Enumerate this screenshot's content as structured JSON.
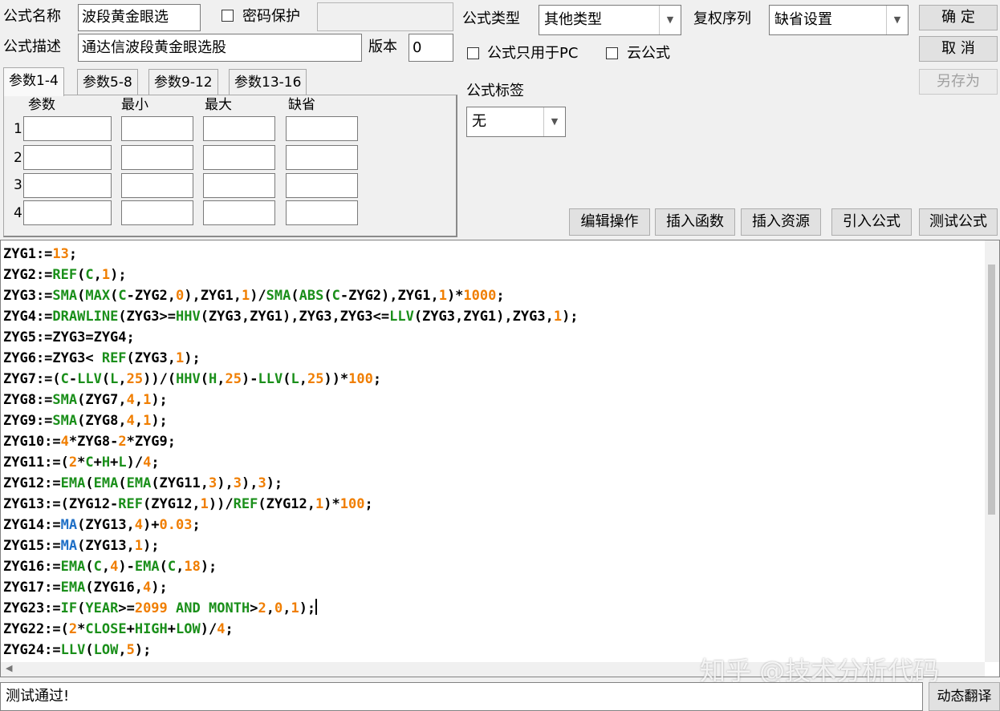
{
  "header": {
    "name_label": "公式名称",
    "name_value": "波段黄金眼选",
    "password_label": "密码保护",
    "desc_label": "公式描述",
    "desc_value": "通达信波段黄金眼选股",
    "version_label": "版本",
    "version_value": "0",
    "type_label": "公式类型",
    "type_value": "其他类型",
    "rights_label": "复权序列",
    "rights_value": "缺省设置",
    "pc_only_label": "公式只用于PC",
    "cloud_label": "云公式",
    "tag_label": "公式标签",
    "tag_value": "无"
  },
  "buttons": {
    "confirm": "确 定",
    "cancel": "取 消",
    "save_as": "另存为",
    "edit_ops": "编辑操作",
    "insert_fn": "插入函数",
    "insert_res": "插入资源",
    "import_formula": "引入公式",
    "test_formula": "测试公式",
    "dynamic_translate": "动态翻译"
  },
  "params": {
    "tabs": [
      "参数1-4",
      "参数5-8",
      "参数9-12",
      "参数13-16"
    ],
    "columns": [
      "参数",
      "最小",
      "最大",
      "缺省"
    ],
    "rows": [
      "1",
      "2",
      "3",
      "4"
    ]
  },
  "status_text": "测试通过!",
  "watermark": "知乎 @技术分析代码",
  "code_lines": [
    [
      [
        "ZYG1:=",
        "id"
      ],
      [
        "13",
        "num"
      ],
      [
        ";",
        "id"
      ]
    ],
    [
      [
        "ZYG2:=",
        "id"
      ],
      [
        "REF",
        "fn"
      ],
      [
        "(",
        "id"
      ],
      [
        "C",
        "fn"
      ],
      [
        ",",
        "id"
      ],
      [
        "1",
        "num"
      ],
      [
        ");",
        "id"
      ]
    ],
    [
      [
        "ZYG3:=",
        "id"
      ],
      [
        "SMA",
        "fn"
      ],
      [
        "(",
        "id"
      ],
      [
        "MAX",
        "fn"
      ],
      [
        "(",
        "id"
      ],
      [
        "C",
        "fn"
      ],
      [
        "-ZYG2,",
        "id"
      ],
      [
        "0",
        "num"
      ],
      [
        "),ZYG1,",
        "id"
      ],
      [
        "1",
        "num"
      ],
      [
        ")/",
        "id"
      ],
      [
        "SMA",
        "fn"
      ],
      [
        "(",
        "id"
      ],
      [
        "ABS",
        "fn"
      ],
      [
        "(",
        "id"
      ],
      [
        "C",
        "fn"
      ],
      [
        "-ZYG2),ZYG1,",
        "id"
      ],
      [
        "1",
        "num"
      ],
      [
        ")*",
        "id"
      ],
      [
        "1000",
        "num"
      ],
      [
        ";",
        "id"
      ]
    ],
    [
      [
        "ZYG4:=",
        "id"
      ],
      [
        "DRAWLINE",
        "fn"
      ],
      [
        "(ZYG3>=",
        "id"
      ],
      [
        "HHV",
        "fn"
      ],
      [
        "(ZYG3,ZYG1),ZYG3,ZYG3<=",
        "id"
      ],
      [
        "LLV",
        "fn"
      ],
      [
        "(ZYG3,ZYG1),ZYG3,",
        "id"
      ],
      [
        "1",
        "num"
      ],
      [
        ");",
        "id"
      ]
    ],
    [
      [
        "ZYG5:=ZYG3=ZYG4;",
        "id"
      ]
    ],
    [
      [
        "ZYG6:=ZYG3< ",
        "id"
      ],
      [
        "REF",
        "fn"
      ],
      [
        "(ZYG3,",
        "id"
      ],
      [
        "1",
        "num"
      ],
      [
        ");",
        "id"
      ]
    ],
    [
      [
        "ZYG7:=(",
        "id"
      ],
      [
        "C",
        "fn"
      ],
      [
        "-",
        "id"
      ],
      [
        "LLV",
        "fn"
      ],
      [
        "(",
        "id"
      ],
      [
        "L",
        "fn"
      ],
      [
        ",",
        "id"
      ],
      [
        "25",
        "num"
      ],
      [
        "))/(",
        "id"
      ],
      [
        "HHV",
        "fn"
      ],
      [
        "(",
        "id"
      ],
      [
        "H",
        "fn"
      ],
      [
        ",",
        "id"
      ],
      [
        "25",
        "num"
      ],
      [
        ")-",
        "id"
      ],
      [
        "LLV",
        "fn"
      ],
      [
        "(",
        "id"
      ],
      [
        "L",
        "fn"
      ],
      [
        ",",
        "id"
      ],
      [
        "25",
        "num"
      ],
      [
        "))*",
        "id"
      ],
      [
        "100",
        "num"
      ],
      [
        ";",
        "id"
      ]
    ],
    [
      [
        "ZYG8:=",
        "id"
      ],
      [
        "SMA",
        "fn"
      ],
      [
        "(ZYG7,",
        "id"
      ],
      [
        "4",
        "num"
      ],
      [
        ",",
        "id"
      ],
      [
        "1",
        "num"
      ],
      [
        ");",
        "id"
      ]
    ],
    [
      [
        "ZYG9:=",
        "id"
      ],
      [
        "SMA",
        "fn"
      ],
      [
        "(ZYG8,",
        "id"
      ],
      [
        "4",
        "num"
      ],
      [
        ",",
        "id"
      ],
      [
        "1",
        "num"
      ],
      [
        ");",
        "id"
      ]
    ],
    [
      [
        "ZYG10:=",
        "id"
      ],
      [
        "4",
        "num"
      ],
      [
        "*ZYG8-",
        "id"
      ],
      [
        "2",
        "num"
      ],
      [
        "*ZYG9;",
        "id"
      ]
    ],
    [
      [
        "ZYG11:=(",
        "id"
      ],
      [
        "2",
        "num"
      ],
      [
        "*",
        "id"
      ],
      [
        "C",
        "fn"
      ],
      [
        "+",
        "id"
      ],
      [
        "H",
        "fn"
      ],
      [
        "+",
        "id"
      ],
      [
        "L",
        "fn"
      ],
      [
        ")/",
        "id"
      ],
      [
        "4",
        "num"
      ],
      [
        ";",
        "id"
      ]
    ],
    [
      [
        "ZYG12:=",
        "id"
      ],
      [
        "EMA",
        "fn"
      ],
      [
        "(",
        "id"
      ],
      [
        "EMA",
        "fn"
      ],
      [
        "(",
        "id"
      ],
      [
        "EMA",
        "fn"
      ],
      [
        "(ZYG11,",
        "id"
      ],
      [
        "3",
        "num"
      ],
      [
        "),",
        "id"
      ],
      [
        "3",
        "num"
      ],
      [
        "),",
        "id"
      ],
      [
        "3",
        "num"
      ],
      [
        ");",
        "id"
      ]
    ],
    [
      [
        "ZYG13:=(ZYG12-",
        "id"
      ],
      [
        "REF",
        "fn"
      ],
      [
        "(ZYG12,",
        "id"
      ],
      [
        "1",
        "num"
      ],
      [
        "))/",
        "id"
      ],
      [
        "REF",
        "fn"
      ],
      [
        "(ZYG12,",
        "id"
      ],
      [
        "1",
        "num"
      ],
      [
        ")*",
        "id"
      ],
      [
        "100",
        "num"
      ],
      [
        ";",
        "id"
      ]
    ],
    [
      [
        "ZYG14:=",
        "id"
      ],
      [
        "MA",
        "bl"
      ],
      [
        "(ZYG13,",
        "id"
      ],
      [
        "4",
        "num"
      ],
      [
        ")+",
        "id"
      ],
      [
        "0.03",
        "num"
      ],
      [
        ";",
        "id"
      ]
    ],
    [
      [
        "ZYG15:=",
        "id"
      ],
      [
        "MA",
        "bl"
      ],
      [
        "(ZYG13,",
        "id"
      ],
      [
        "1",
        "num"
      ],
      [
        ");",
        "id"
      ]
    ],
    [
      [
        "ZYG16:=",
        "id"
      ],
      [
        "EMA",
        "fn"
      ],
      [
        "(",
        "id"
      ],
      [
        "C",
        "fn"
      ],
      [
        ",",
        "id"
      ],
      [
        "4",
        "num"
      ],
      [
        ")-",
        "id"
      ],
      [
        "EMA",
        "fn"
      ],
      [
        "(",
        "id"
      ],
      [
        "C",
        "fn"
      ],
      [
        ",",
        "id"
      ],
      [
        "18",
        "num"
      ],
      [
        ");",
        "id"
      ]
    ],
    [
      [
        "ZYG17:=",
        "id"
      ],
      [
        "EMA",
        "fn"
      ],
      [
        "(ZYG16,",
        "id"
      ],
      [
        "4",
        "num"
      ],
      [
        ");",
        "id"
      ]
    ],
    [
      [
        "ZYG23:=",
        "id"
      ],
      [
        "IF",
        "fn"
      ],
      [
        "(",
        "id"
      ],
      [
        "YEAR",
        "fn"
      ],
      [
        ">=",
        "id"
      ],
      [
        "2099",
        "num"
      ],
      [
        " ",
        "id"
      ],
      [
        "AND",
        "fn"
      ],
      [
        " ",
        "id"
      ],
      [
        "MONTH",
        "fn"
      ],
      [
        ">",
        "id"
      ],
      [
        "2",
        "num"
      ],
      [
        ",",
        "id"
      ],
      [
        "0",
        "num"
      ],
      [
        ",",
        "id"
      ],
      [
        "1",
        "num"
      ],
      [
        ");",
        "id"
      ]
    ],
    [
      [
        "ZYG22:=(",
        "id"
      ],
      [
        "2",
        "num"
      ],
      [
        "*",
        "id"
      ],
      [
        "CLOSE",
        "fn"
      ],
      [
        "+",
        "id"
      ],
      [
        "HIGH",
        "fn"
      ],
      [
        "+",
        "id"
      ],
      [
        "LOW",
        "fn"
      ],
      [
        ")/",
        "id"
      ],
      [
        "4",
        "num"
      ],
      [
        ";",
        "id"
      ]
    ],
    [
      [
        "ZYG24:=",
        "id"
      ],
      [
        "LLV",
        "fn"
      ],
      [
        "(",
        "id"
      ],
      [
        "LOW",
        "fn"
      ],
      [
        ",",
        "id"
      ],
      [
        "5",
        "num"
      ],
      [
        ");",
        "id"
      ]
    ]
  ]
}
